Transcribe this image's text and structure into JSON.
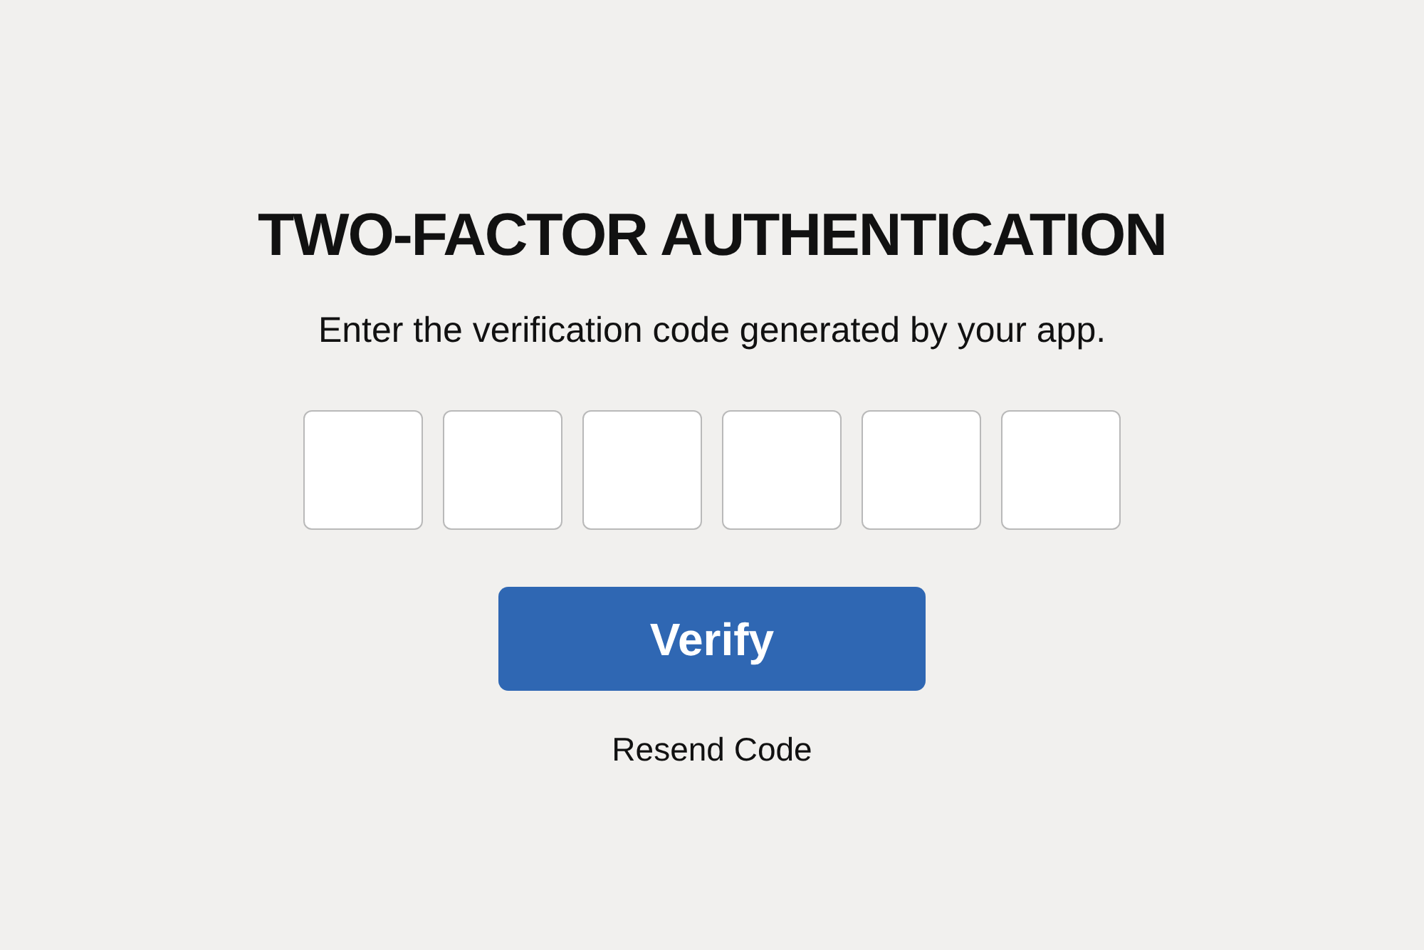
{
  "title": "TWO-FACTOR AUTHENTICATION",
  "instructions": "Enter the verification code generated by your app.",
  "code_boxes": [
    {
      "kind": "digit"
    },
    {
      "kind": "digit"
    },
    {
      "kind": "digit"
    },
    {
      "kind": "digit"
    },
    {
      "kind": "digit"
    },
    {
      "kind": "digit"
    }
  ],
  "verify_button": {
    "label": "Verify"
  },
  "resend_link": {
    "label": "Resend Code"
  }
}
